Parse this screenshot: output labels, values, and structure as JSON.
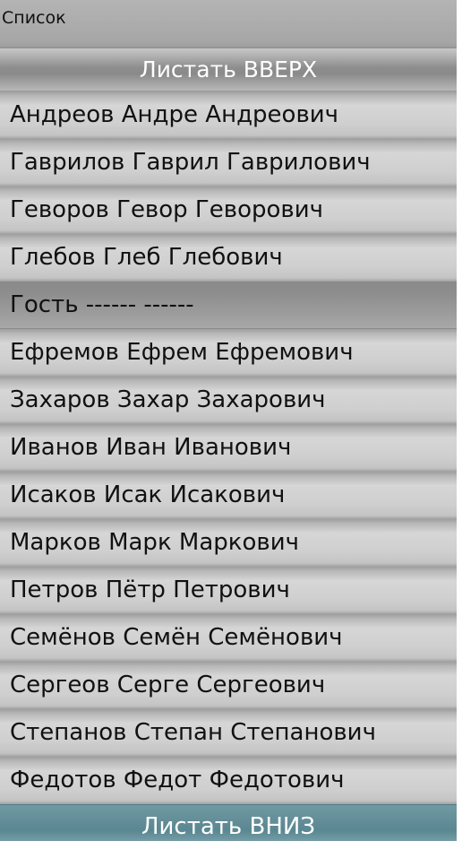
{
  "header": {
    "title": "Список"
  },
  "controls": {
    "scroll_up_label": "Листать ВВЕРХ",
    "scroll_down_label": "Листать ВНИЗ"
  },
  "list": {
    "items": [
      {
        "label": "Андреов Андре Андреович"
      },
      {
        "label": "Гаврилов Гаврил Гаврилович"
      },
      {
        "label": "Геворов Гевор Геворович"
      },
      {
        "label": "Глебов Глеб Глебович"
      },
      {
        "label": "Гость ------ ------"
      },
      {
        "label": "Ефремов Ефрем Ефремович"
      },
      {
        "label": "Захаров Захар Захарович"
      },
      {
        "label": "Иванов Иван Иванович"
      },
      {
        "label": "Исаков Исак Исакович"
      },
      {
        "label": "Марков Марк Маркович"
      },
      {
        "label": "Петров Пётр Петрович"
      },
      {
        "label": "Семёнов Семён Семёнович"
      },
      {
        "label": "Сергеов Серге Сергеович"
      },
      {
        "label": "Степанов Степан Степанович"
      },
      {
        "label": "Федотов Федот Федотович"
      }
    ],
    "selected_index": 4
  },
  "colors": {
    "scroll_down_accent": "#628d97",
    "selected_item": "#8c8c8c"
  }
}
